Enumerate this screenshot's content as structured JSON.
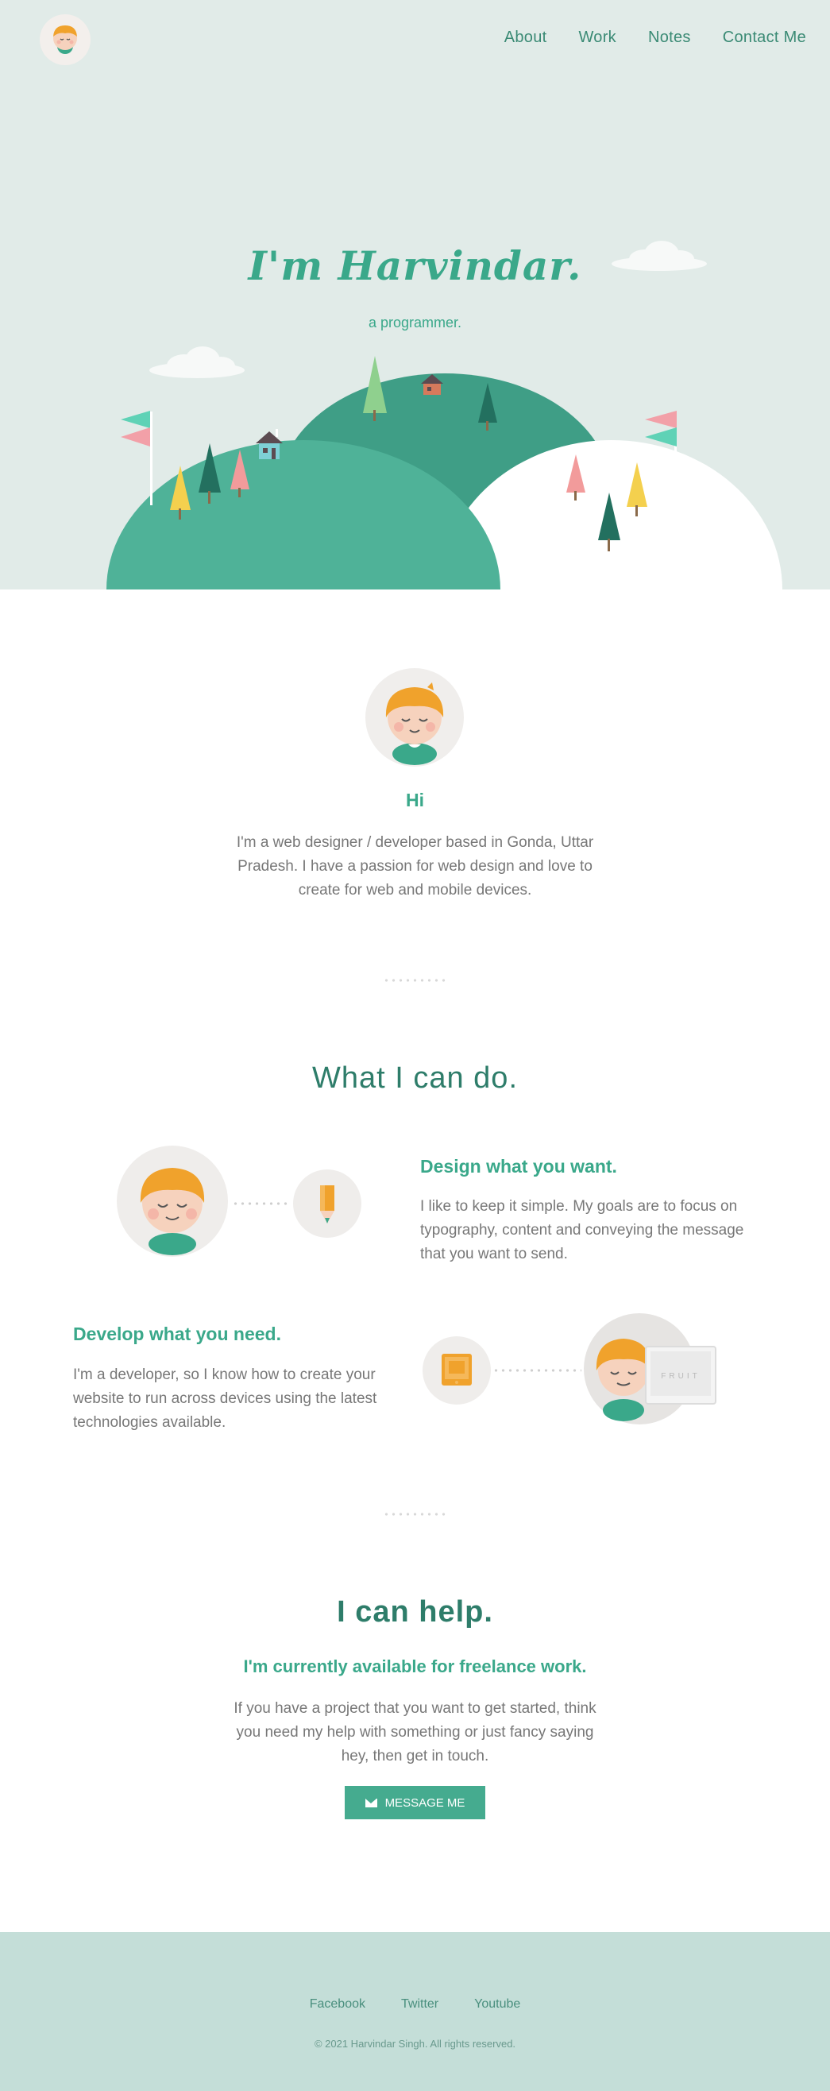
{
  "nav": {
    "items": [
      "About",
      "Work",
      "Notes",
      "Contact Me"
    ]
  },
  "hero": {
    "title": "I'm Harvindar.",
    "subtitle": "a programmer."
  },
  "about": {
    "heading": "Hi",
    "text": "I'm a web designer / developer based in Gonda, Uttar Pradesh. I have a passion for web design and love to create for web and mobile devices."
  },
  "services": {
    "title": "What I can do.",
    "design": {
      "heading": "Design what you want.",
      "text": "I like to keep it simple. My goals are to focus on typography, content and conveying the message that you want to send."
    },
    "develop": {
      "heading": "Develop what you need.",
      "text": "I'm a developer, so I know how to create your website to run across devices using the latest technologies available.",
      "monitor_brand": "FRUIT"
    }
  },
  "contact": {
    "title": "I can help.",
    "subtitle": "I'm currently available for freelance work.",
    "text": "If you have a project that you want to get started, think you need my help with something or just fancy saying hey, then get in touch.",
    "button_label": "MESSAGE ME",
    "button_icon": "envelope-icon"
  },
  "footer": {
    "links": [
      "Facebook",
      "Twitter",
      "Youtube"
    ],
    "copyright": "© 2021 Harvindar Singh. All rights reserved."
  },
  "colors": {
    "hero_bg": "#e1ebe8",
    "accent": "#3aa88a",
    "dark_accent": "#2e7d6a",
    "button": "#45ab8f",
    "footer_bg": "#c4ded8"
  }
}
